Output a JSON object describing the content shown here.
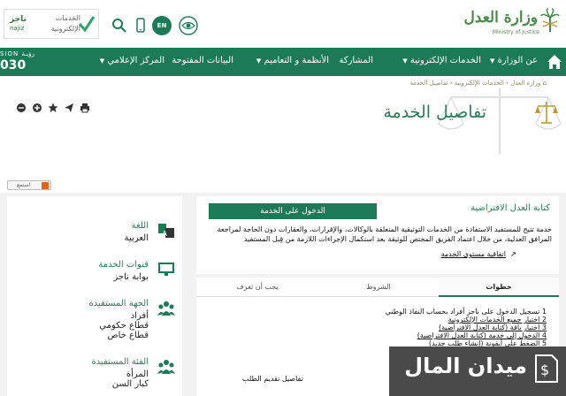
{
  "header": {
    "ministry_name": "وزارة العدل",
    "ministry_name_en": "Ministry of Justice",
    "najiz_line1": "الخدمات",
    "najiz_line2": "الإلكترونية",
    "najiz_brand": "ناجز",
    "najiz_brand_en": "najiz",
    "icons": [
      "eye-icon",
      "en-language-icon",
      "mobile-icon",
      "search-icon"
    ],
    "lang_label": "EN"
  },
  "nav": {
    "items": [
      {
        "label": "عن الوزارة"
      },
      {
        "label": "الخدمات الإلكترونية"
      },
      {
        "label": "المشاركة"
      },
      {
        "label": "الأنظمة و التعاميم"
      },
      {
        "label": "البيانات المفتوحة"
      },
      {
        "label": "المركز الإعلامي"
      }
    ],
    "vision_line1": "SION رؤيـة",
    "vision_line2": "030"
  },
  "breadcrumb": {
    "items": [
      "وزارة العدل",
      "الخدمات الإلكترونية",
      "تفاصيل الخدمة"
    ]
  },
  "page": {
    "title": "تفاصيل الخدمة",
    "listen_label": "استمع"
  },
  "info_panel": {
    "rows": [
      {
        "label": "اللغة",
        "value": "العربية",
        "icon": "language-icon"
      },
      {
        "label": "قنوات الخدمة",
        "value": "بوابة ناجز",
        "icon": "monitor-icon"
      },
      {
        "label": "الجهة المستفيدة",
        "value": "أفراد\nقطاع حكومي\nقطاع خاص",
        "icon": "people-group-icon"
      },
      {
        "label": "الفئة المستفيدة",
        "value": "المرأة\nكبار السن",
        "icon": "people-group-icon"
      }
    ]
  },
  "service": {
    "heading": "كتابة العدل الافتراضية",
    "enter_button": "الدخول على الخدمة",
    "description": "خدمة تتيح للمستفيد الاستفادة من الخدمات التوثيقية المتعلقة بالوكالات، والإقرارات، والعقارات دون الحاجة لمراجعة المرافق العدلية، من خلال اعتماد الفريق المختص للوثيقة بعد استكمال الإجراءات اللازمة من قِبل المستفيد",
    "agreement_link": "اتفاقية مستوى الخدمة"
  },
  "tabs": {
    "items": [
      {
        "label": "خطوات"
      },
      {
        "label": "الشروط"
      },
      {
        "label": "يجب أن تعرف"
      }
    ],
    "active": 0
  },
  "steps": {
    "items": [
      "1 تسجيل الدخول على ناجز أفراد بحساب النفاذ الوطني",
      "2 اختيار جميع الخدمات الإلكترونية",
      "3 اختيار باقة (كتابة العدل الافتراضية)",
      "4 الدخول إلى خدمة (كتابة العدل الافتراضية)",
      "5 الضغط على أيقونة (إنشاء طلب جديد)"
    ],
    "extra": "تفاصيل تقديم الطلب"
  },
  "watermark": {
    "text": "ميدان المال"
  }
}
